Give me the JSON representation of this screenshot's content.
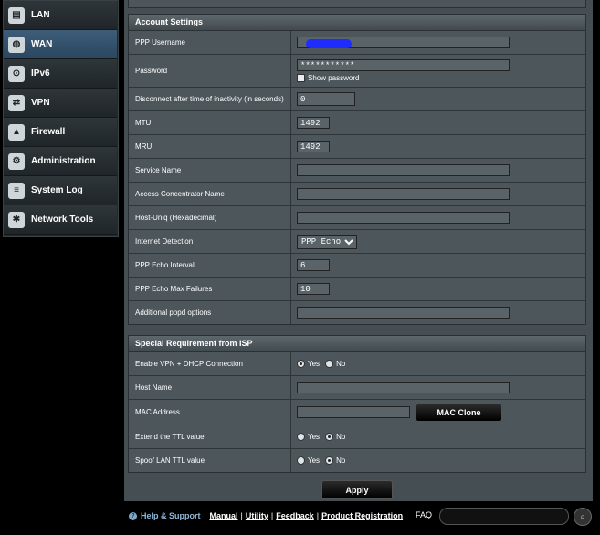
{
  "sidebar": {
    "items": [
      {
        "label": "LAN",
        "icon": "lan-icon"
      },
      {
        "label": "WAN",
        "icon": "wan-icon",
        "active": true
      },
      {
        "label": "IPv6",
        "icon": "ipv6-icon"
      },
      {
        "label": "VPN",
        "icon": "vpn-icon"
      },
      {
        "label": "Firewall",
        "icon": "firewall-icon"
      },
      {
        "label": "Administration",
        "icon": "administration-icon"
      },
      {
        "label": "System Log",
        "icon": "system-log-icon"
      },
      {
        "label": "Network Tools",
        "icon": "network-tools-icon"
      }
    ]
  },
  "account": {
    "title": "Account Settings",
    "ppp_username_label": "PPP Username",
    "password_label": "Password",
    "password_value": "***********",
    "show_password_label": "Show password",
    "disconnect_label": "Disconnect after time of inactivity (in seconds)",
    "disconnect_value": "0",
    "mtu_label": "MTU",
    "mtu_value": "1492",
    "mru_label": "MRU",
    "mru_value": "1492",
    "service_name_label": "Service Name",
    "access_concentrator_label": "Access Concentrator Name",
    "host_uniq_label": "Host-Uniq (Hexadecimal)",
    "internet_detection_label": "Internet Detection",
    "internet_detection_value": "PPP Echo",
    "echo_interval_label": "PPP Echo Interval",
    "echo_interval_value": "6",
    "echo_max_failures_label": "PPP Echo Max Failures",
    "echo_max_failures_value": "10",
    "pppd_options_label": "Additional pppd options"
  },
  "special": {
    "title": "Special Requirement from ISP",
    "vpn_dhcp_label": "Enable VPN + DHCP Connection",
    "host_name_label": "Host Name",
    "mac_address_label": "MAC Address",
    "mac_clone_label": "MAC Clone",
    "extend_ttl_label": "Extend the TTL value",
    "spoof_ttl_label": "Spoof LAN TTL value",
    "yes": "Yes",
    "no": "No"
  },
  "apply_label": "Apply",
  "footer": {
    "help_support": "Help & Support",
    "manual": "Manual",
    "utility": "Utility",
    "feedback": "Feedback",
    "product_registration": "Product Registration",
    "faq": "FAQ"
  },
  "colors": {
    "username_redaction": "#1f2cff",
    "active_menu": "#3e5d78"
  }
}
